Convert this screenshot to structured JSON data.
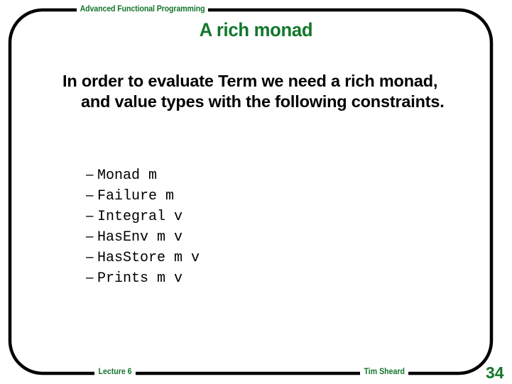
{
  "slide": {
    "header_label": "Advanced Functional Programming",
    "title": "A rich monad",
    "body": "In order to evaluate Term we need a rich monad, and value types with the following constraints.",
    "bullet_marker": "–",
    "constraints": [
      "Monad m",
      "Failure m",
      "Integral v",
      "HasEnv m v",
      "HasStore m v",
      "Prints m v"
    ],
    "footer": {
      "lecture": "Lecture 6",
      "author": "Tim Sheard",
      "page_number": "34"
    },
    "colors": {
      "accent_green": "#14752c",
      "title_green": "#11772b",
      "frame_black": "#000000",
      "background": "#ffffff",
      "body_text": "#000000"
    }
  }
}
